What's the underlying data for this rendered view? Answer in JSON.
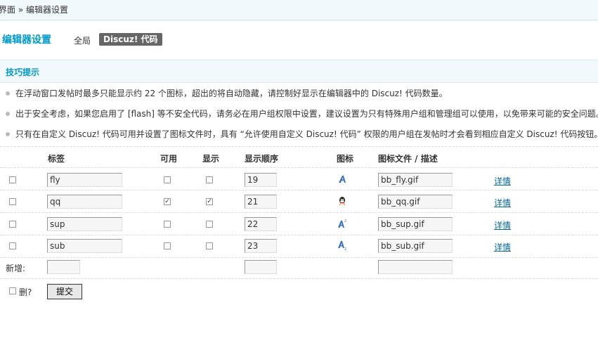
{
  "breadcrumb": {
    "text": "界面 » 编辑器设置"
  },
  "page_title": "编辑器设置",
  "tabs": [
    {
      "label": "全局",
      "active": false
    },
    {
      "label": "Discuz! 代码",
      "active": true
    }
  ],
  "tips": {
    "title": "技巧提示",
    "items": [
      "在浮动窗口发帖时最多只能显示约 22 个图标，超出的将自动隐藏，请控制好显示在编辑器中的 Discuz! 代码数量。",
      "出于安全考虑，如果您启用了 [flash] 等不安全代码，请务必在用户组权限中设置，建议设置为只有特殊用户组和管理组可以使用，以免带来可能的安全问题。",
      "只有在自定义 Discuz! 代码可用并设置了图标文件时，具有 “允许使用自定义 Discuz! 代码” 权限的用户组在发帖时才会看到相应自定义 Discuz! 代码按钮。"
    ]
  },
  "table": {
    "headers": {
      "tag": "标签",
      "available": "可用",
      "display": "显示",
      "order": "显示顺序",
      "icon": "图标",
      "icon_file": "图标文件 / 描述"
    },
    "rows": [
      {
        "tag": "fly",
        "available": false,
        "display": false,
        "order": "19",
        "icon": "fly-icon",
        "file": "bb_fly.gif",
        "detail": "详情"
      },
      {
        "tag": "qq",
        "available": true,
        "display": true,
        "order": "21",
        "icon": "qq-penguin-icon",
        "file": "bb_qq.gif",
        "detail": "详情"
      },
      {
        "tag": "sup",
        "available": false,
        "display": false,
        "order": "22",
        "icon": "superscript-icon",
        "file": "bb_sup.gif",
        "detail": "详情"
      },
      {
        "tag": "sub",
        "available": false,
        "display": false,
        "order": "23",
        "icon": "subscript-icon",
        "file": "bb_sub.gif",
        "detail": "详情"
      }
    ],
    "new_row_label": "新增:",
    "delete_label": "删?",
    "submit_label": "提交"
  },
  "colors": {
    "accent": "#0099cc",
    "link": "#006699",
    "header_bg": "#f2f9fd"
  }
}
